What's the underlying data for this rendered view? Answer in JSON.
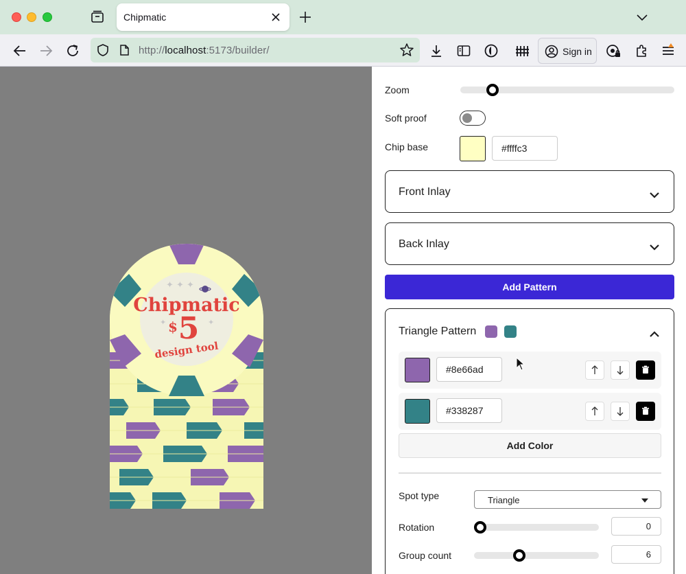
{
  "browser": {
    "tab_title": "Chipmatic",
    "url_prefix": "http://",
    "url_host": "localhost",
    "url_rest": ":5173/builder/",
    "signin_label": "Sign in"
  },
  "chip": {
    "brand": "Chipmatic",
    "denomination_symbol": "$",
    "denomination_value": "5",
    "tagline": "design tool"
  },
  "panel": {
    "zoom": {
      "label": "Zoom",
      "value_fraction": 0.13
    },
    "soft_proof": {
      "label": "Soft proof",
      "enabled": false
    },
    "chip_base": {
      "label": "Chip base",
      "color": "#ffffc3",
      "hex": "#ffffc3"
    },
    "front_inlay": {
      "title": "Front Inlay"
    },
    "back_inlay": {
      "title": "Back Inlay"
    },
    "add_pattern_label": "Add Pattern",
    "pattern": {
      "title": "Triangle Pattern",
      "colors": [
        {
          "hex": "#8e66ad",
          "swatch": "#8e66ad"
        },
        {
          "hex": "#338287",
          "swatch": "#338287"
        }
      ],
      "add_color_label": "Add Color",
      "spot_type": {
        "label": "Spot type",
        "value": "Triangle"
      },
      "rotation": {
        "label": "Rotation",
        "value": "0",
        "fraction": 0.0
      },
      "group_count": {
        "label": "Group count",
        "value": "6",
        "fraction": 0.35
      }
    }
  },
  "colors": {
    "accent": "#3b27d6",
    "canvas_bg": "#7f7f7f",
    "chrome_green": "#d6e8dc"
  }
}
